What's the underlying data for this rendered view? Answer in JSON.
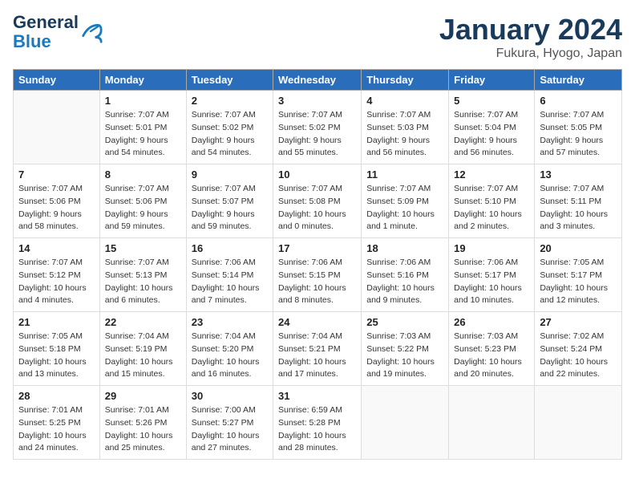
{
  "logo": {
    "line1": "General",
    "line2": "Blue"
  },
  "title": "January 2024",
  "subtitle": "Fukura, Hyogo, Japan",
  "days_of_week": [
    "Sunday",
    "Monday",
    "Tuesday",
    "Wednesday",
    "Thursday",
    "Friday",
    "Saturday"
  ],
  "weeks": [
    [
      {
        "day": "",
        "sunrise": "",
        "sunset": "",
        "daylight": ""
      },
      {
        "day": "1",
        "sunrise": "Sunrise: 7:07 AM",
        "sunset": "Sunset: 5:01 PM",
        "daylight": "Daylight: 9 hours and 54 minutes."
      },
      {
        "day": "2",
        "sunrise": "Sunrise: 7:07 AM",
        "sunset": "Sunset: 5:02 PM",
        "daylight": "Daylight: 9 hours and 54 minutes."
      },
      {
        "day": "3",
        "sunrise": "Sunrise: 7:07 AM",
        "sunset": "Sunset: 5:02 PM",
        "daylight": "Daylight: 9 hours and 55 minutes."
      },
      {
        "day": "4",
        "sunrise": "Sunrise: 7:07 AM",
        "sunset": "Sunset: 5:03 PM",
        "daylight": "Daylight: 9 hours and 56 minutes."
      },
      {
        "day": "5",
        "sunrise": "Sunrise: 7:07 AM",
        "sunset": "Sunset: 5:04 PM",
        "daylight": "Daylight: 9 hours and 56 minutes."
      },
      {
        "day": "6",
        "sunrise": "Sunrise: 7:07 AM",
        "sunset": "Sunset: 5:05 PM",
        "daylight": "Daylight: 9 hours and 57 minutes."
      }
    ],
    [
      {
        "day": "7",
        "sunrise": "Sunrise: 7:07 AM",
        "sunset": "Sunset: 5:06 PM",
        "daylight": "Daylight: 9 hours and 58 minutes."
      },
      {
        "day": "8",
        "sunrise": "Sunrise: 7:07 AM",
        "sunset": "Sunset: 5:06 PM",
        "daylight": "Daylight: 9 hours and 59 minutes."
      },
      {
        "day": "9",
        "sunrise": "Sunrise: 7:07 AM",
        "sunset": "Sunset: 5:07 PM",
        "daylight": "Daylight: 9 hours and 59 minutes."
      },
      {
        "day": "10",
        "sunrise": "Sunrise: 7:07 AM",
        "sunset": "Sunset: 5:08 PM",
        "daylight": "Daylight: 10 hours and 0 minutes."
      },
      {
        "day": "11",
        "sunrise": "Sunrise: 7:07 AM",
        "sunset": "Sunset: 5:09 PM",
        "daylight": "Daylight: 10 hours and 1 minute."
      },
      {
        "day": "12",
        "sunrise": "Sunrise: 7:07 AM",
        "sunset": "Sunset: 5:10 PM",
        "daylight": "Daylight: 10 hours and 2 minutes."
      },
      {
        "day": "13",
        "sunrise": "Sunrise: 7:07 AM",
        "sunset": "Sunset: 5:11 PM",
        "daylight": "Daylight: 10 hours and 3 minutes."
      }
    ],
    [
      {
        "day": "14",
        "sunrise": "Sunrise: 7:07 AM",
        "sunset": "Sunset: 5:12 PM",
        "daylight": "Daylight: 10 hours and 4 minutes."
      },
      {
        "day": "15",
        "sunrise": "Sunrise: 7:07 AM",
        "sunset": "Sunset: 5:13 PM",
        "daylight": "Daylight: 10 hours and 6 minutes."
      },
      {
        "day": "16",
        "sunrise": "Sunrise: 7:06 AM",
        "sunset": "Sunset: 5:14 PM",
        "daylight": "Daylight: 10 hours and 7 minutes."
      },
      {
        "day": "17",
        "sunrise": "Sunrise: 7:06 AM",
        "sunset": "Sunset: 5:15 PM",
        "daylight": "Daylight: 10 hours and 8 minutes."
      },
      {
        "day": "18",
        "sunrise": "Sunrise: 7:06 AM",
        "sunset": "Sunset: 5:16 PM",
        "daylight": "Daylight: 10 hours and 9 minutes."
      },
      {
        "day": "19",
        "sunrise": "Sunrise: 7:06 AM",
        "sunset": "Sunset: 5:17 PM",
        "daylight": "Daylight: 10 hours and 10 minutes."
      },
      {
        "day": "20",
        "sunrise": "Sunrise: 7:05 AM",
        "sunset": "Sunset: 5:17 PM",
        "daylight": "Daylight: 10 hours and 12 minutes."
      }
    ],
    [
      {
        "day": "21",
        "sunrise": "Sunrise: 7:05 AM",
        "sunset": "Sunset: 5:18 PM",
        "daylight": "Daylight: 10 hours and 13 minutes."
      },
      {
        "day": "22",
        "sunrise": "Sunrise: 7:04 AM",
        "sunset": "Sunset: 5:19 PM",
        "daylight": "Daylight: 10 hours and 15 minutes."
      },
      {
        "day": "23",
        "sunrise": "Sunrise: 7:04 AM",
        "sunset": "Sunset: 5:20 PM",
        "daylight": "Daylight: 10 hours and 16 minutes."
      },
      {
        "day": "24",
        "sunrise": "Sunrise: 7:04 AM",
        "sunset": "Sunset: 5:21 PM",
        "daylight": "Daylight: 10 hours and 17 minutes."
      },
      {
        "day": "25",
        "sunrise": "Sunrise: 7:03 AM",
        "sunset": "Sunset: 5:22 PM",
        "daylight": "Daylight: 10 hours and 19 minutes."
      },
      {
        "day": "26",
        "sunrise": "Sunrise: 7:03 AM",
        "sunset": "Sunset: 5:23 PM",
        "daylight": "Daylight: 10 hours and 20 minutes."
      },
      {
        "day": "27",
        "sunrise": "Sunrise: 7:02 AM",
        "sunset": "Sunset: 5:24 PM",
        "daylight": "Daylight: 10 hours and 22 minutes."
      }
    ],
    [
      {
        "day": "28",
        "sunrise": "Sunrise: 7:01 AM",
        "sunset": "Sunset: 5:25 PM",
        "daylight": "Daylight: 10 hours and 24 minutes."
      },
      {
        "day": "29",
        "sunrise": "Sunrise: 7:01 AM",
        "sunset": "Sunset: 5:26 PM",
        "daylight": "Daylight: 10 hours and 25 minutes."
      },
      {
        "day": "30",
        "sunrise": "Sunrise: 7:00 AM",
        "sunset": "Sunset: 5:27 PM",
        "daylight": "Daylight: 10 hours and 27 minutes."
      },
      {
        "day": "31",
        "sunrise": "Sunrise: 6:59 AM",
        "sunset": "Sunset: 5:28 PM",
        "daylight": "Daylight: 10 hours and 28 minutes."
      },
      {
        "day": "",
        "sunrise": "",
        "sunset": "",
        "daylight": ""
      },
      {
        "day": "",
        "sunrise": "",
        "sunset": "",
        "daylight": ""
      },
      {
        "day": "",
        "sunrise": "",
        "sunset": "",
        "daylight": ""
      }
    ]
  ]
}
